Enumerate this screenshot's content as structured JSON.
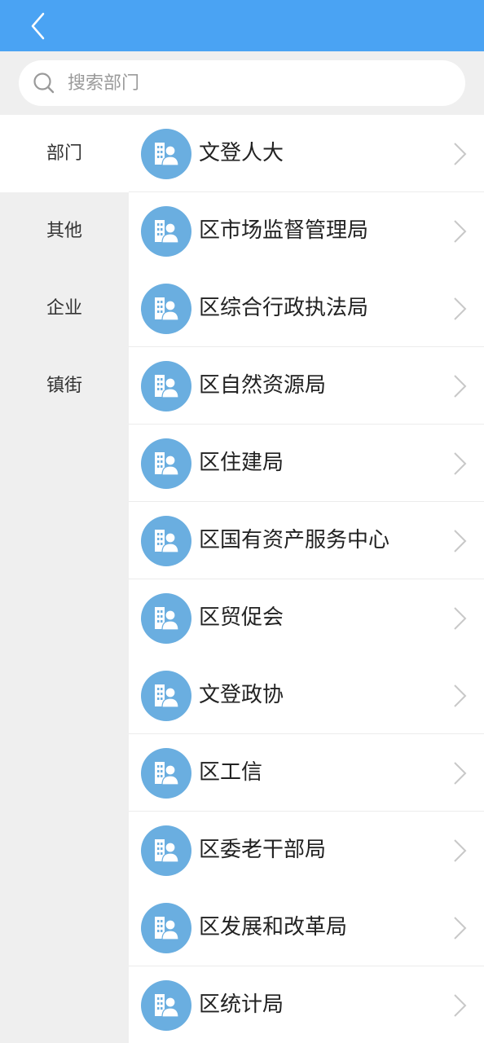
{
  "colors": {
    "accent": "#4aa3f3",
    "avatar": "#6aaee0",
    "sidebar_bg": "#efefef"
  },
  "header": {
    "back_icon": "chevron-left-icon"
  },
  "search": {
    "placeholder": "搜索部门",
    "value": "",
    "icon": "search-icon"
  },
  "sidebar": {
    "items": [
      {
        "label": "部门",
        "active": true
      },
      {
        "label": "其他",
        "active": false
      },
      {
        "label": "企业",
        "active": false
      },
      {
        "label": "镇街",
        "active": false
      }
    ]
  },
  "list": {
    "item_icon": "department-building-icon",
    "items": [
      {
        "label": "文登人大"
      },
      {
        "label": "区市场监督管理局"
      },
      {
        "label": "区综合行政执法局"
      },
      {
        "label": "区自然资源局"
      },
      {
        "label": "区住建局"
      },
      {
        "label": "区国有资产服务中心"
      },
      {
        "label": "区贸促会"
      },
      {
        "label": "文登政协"
      },
      {
        "label": "区工信"
      },
      {
        "label": "区委老干部局"
      },
      {
        "label": "区发展和改革局"
      },
      {
        "label": "区统计局"
      }
    ]
  }
}
